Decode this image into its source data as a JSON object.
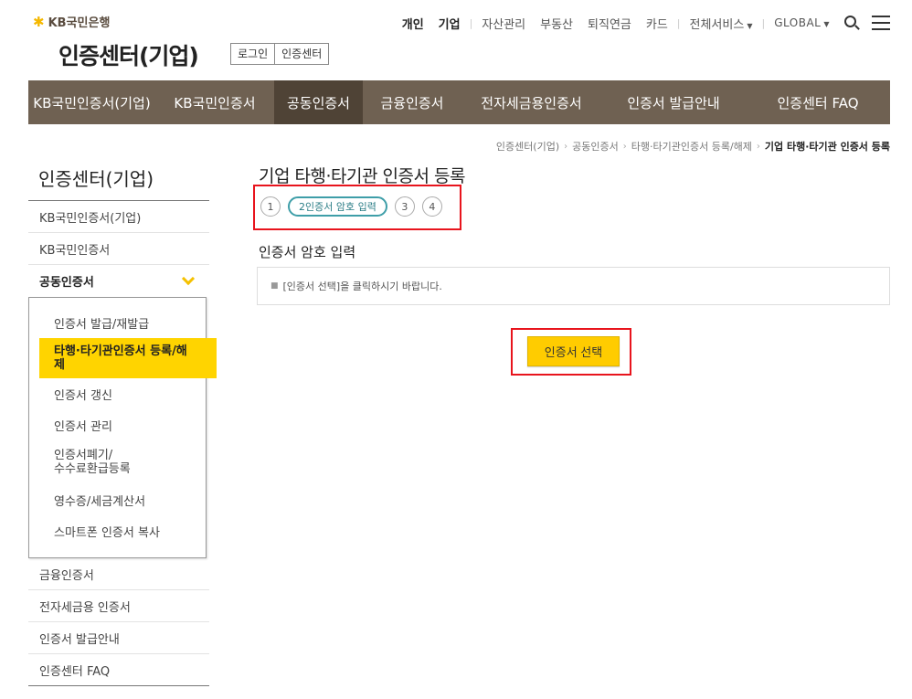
{
  "header": {
    "logo_text": "KB국민은행",
    "site_title": "인증센터(기업)",
    "buttons": [
      "로그인",
      "인증센터"
    ],
    "topnav": {
      "personal": "개인",
      "corporate": "기업",
      "asset": "자산관리",
      "realestate": "부동산",
      "pension": "퇴직연금",
      "card": "카드",
      "all_services": "전체서비스",
      "global": "GLOBAL"
    }
  },
  "gnb": {
    "tabs": [
      "KB국민인증서(기업)",
      "KB국민인증서",
      "공동인증서",
      "금융인증서",
      "전자세금용인증서",
      "인증서 발급안내",
      "인증센터 FAQ"
    ]
  },
  "breadcrumb": {
    "items": [
      "인증센터(기업)",
      "공동인증서",
      "타행·타기관인증서 등록/해제"
    ],
    "current": "기업 타행·타기관 인증서 등록"
  },
  "sidebar": {
    "title": "인증센터(기업)",
    "items": [
      "KB국민인증서(기업)",
      "KB국민인증서",
      "공동인증서"
    ],
    "sub_items": [
      "인증서 발급/재발급",
      "타행·타기관인증서 등록/해제",
      "인증서 갱신",
      "인증서 관리",
      "인증서폐기/수수료환급등록",
      "영수증/세금계산서",
      "스마트폰 인증서 복사"
    ],
    "sub_item_lines": [
      "인증서폐기/",
      "수수료환급등록"
    ],
    "sub_active_lines": [
      "타행·타기관인증서 등록/해",
      "제"
    ],
    "bottom_items": [
      "금융인증서",
      "전자세금용 인증서",
      "인증서 발급안내",
      "인증센터 FAQ"
    ]
  },
  "content": {
    "title": "기업 타행·타기관 인증서 등록",
    "steps": [
      "1",
      "2인증서 암호 입력",
      "3",
      "4"
    ],
    "section_title": "인증서 암호 입력",
    "notice": "[인증서 선택]을 클릭하시기 바랍니다.",
    "select_button": "인증서 선택"
  },
  "colors": {
    "gnb_bg": "#6f6152",
    "gnb_active": "#4f4336",
    "accent_yellow": "#ffcc00",
    "highlight_red": "#e8141d",
    "step_teal": "#3e9ea8"
  }
}
